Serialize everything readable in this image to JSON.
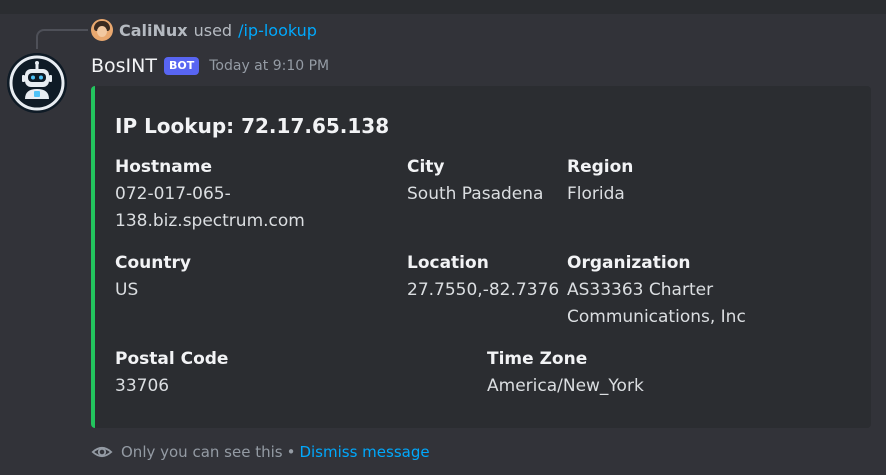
{
  "reply": {
    "user": "CaliNux",
    "used_text": "used",
    "command": "/ip-lookup"
  },
  "message": {
    "username": "BosINT",
    "bot_badge": "BOT",
    "timestamp": "Today at 9:10 PM"
  },
  "embed": {
    "accent_color": "#23c55e",
    "title": "IP Lookup: 72.17.65.138",
    "fields": [
      {
        "name": "Hostname",
        "value_lines": [
          "072-017-065-",
          "138.biz.spectrum.com"
        ]
      },
      {
        "name": "City",
        "value_lines": [
          "South Pasadena"
        ]
      },
      {
        "name": "Region",
        "value_lines": [
          "Florida"
        ]
      },
      {
        "name": "Country",
        "value_lines": [
          "US"
        ]
      },
      {
        "name": "Location",
        "value_lines": [
          "27.7550,-82.7376"
        ]
      },
      {
        "name": "Organization",
        "value_lines": [
          "AS33363 Charter",
          "Communications, Inc"
        ]
      },
      {
        "name": "Postal Code",
        "value_lines": [
          "33706"
        ]
      },
      {
        "name": "Time Zone",
        "value_lines": [
          "America/New_York"
        ]
      }
    ]
  },
  "ephemeral": {
    "notice": "Only you can see this",
    "separator": "•",
    "dismiss_label": "Dismiss message"
  },
  "colors": {
    "background": "#323339",
    "embed_background": "#2b2d31",
    "link": "#00a8fc",
    "badge": "#5865f2"
  },
  "icons": {
    "ephemeral": "eye-icon",
    "bot_avatar": "robot-avatar"
  }
}
